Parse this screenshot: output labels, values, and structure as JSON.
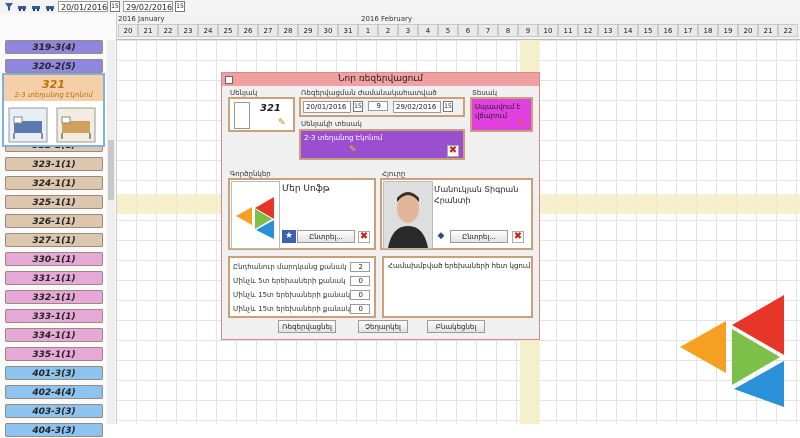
{
  "toolbar": {
    "start_date": "20/01/2016",
    "end_date": "29/02/2016",
    "cal_label": "15"
  },
  "timeline": {
    "month1": "2016 January",
    "month2": "2016 February",
    "days": [
      "20",
      "21",
      "22",
      "23",
      "24",
      "25",
      "26",
      "27",
      "28",
      "29",
      "30",
      "31",
      "1",
      "2",
      "3",
      "4",
      "5",
      "6",
      "7",
      "8",
      "9",
      "10",
      "11",
      "12",
      "13",
      "14",
      "15",
      "16",
      "17",
      "18",
      "19",
      "20",
      "21",
      "22"
    ]
  },
  "rooms": [
    {
      "label": "319-3(4)",
      "color": "#8f86e0"
    },
    {
      "label": "320-2(5)",
      "color": "#8f86e0"
    },
    {
      "label": "322-1(1)",
      "color": "#dcc7ae"
    },
    {
      "label": "323-1(1)",
      "color": "#dcc7ae"
    },
    {
      "label": "324-1(1)",
      "color": "#dcc7ae"
    },
    {
      "label": "325-1(1)",
      "color": "#dcc7ae"
    },
    {
      "label": "326-1(1)",
      "color": "#dcc7ae"
    },
    {
      "label": "327-1(1)",
      "color": "#dcc7ae"
    },
    {
      "label": "330-1(1)",
      "color": "#e6a8d6"
    },
    {
      "label": "331-1(1)",
      "color": "#e6a8d6"
    },
    {
      "label": "332-1(1)",
      "color": "#e6a8d6"
    },
    {
      "label": "333-1(1)",
      "color": "#e6a8d6"
    },
    {
      "label": "334-1(1)",
      "color": "#e6a8d6"
    },
    {
      "label": "335-1(1)",
      "color": "#e6a8d6"
    },
    {
      "label": "401-3(3)",
      "color": "#8dc4ef"
    },
    {
      "label": "402-4(4)",
      "color": "#8dc4ef"
    },
    {
      "label": "403-3(3)",
      "color": "#8dc4ef"
    },
    {
      "label": "404-3(3)",
      "color": "#8dc4ef"
    }
  ],
  "selected_room": {
    "number": "321",
    "type": "2-3 տեղանոց Էկոնոմ"
  },
  "dialog": {
    "title": "Նոր ռեզերվացում",
    "room_label": "Սենյակ",
    "room_number": "321",
    "period_label": "Ռեզերվացման ժամանակահատված",
    "start_date": "20/01/2016",
    "nights": "9",
    "end_date": "29/02/2016",
    "cal_label": "15",
    "type_label": "Տեսակ",
    "type_value": "Սպասվում է վճարում",
    "room_type_label": "Սենյակի տեսակ",
    "room_type_value": "2-3 տեղանոց Էկոնոմ",
    "partners_label": "Գործընկեր",
    "partner_name": "Մեր Սոֆթ",
    "partner_btn": "Ընտրել...",
    "guest_label": "Հյուրը",
    "guest_name": "Մանուկյան Տիգրան Հրանտի",
    "guest_btn": "Ընտրել...",
    "counts": [
      {
        "label": "Ընդհանուր մարդկանց քանակ",
        "value": "2"
      },
      {
        "label": "Մինչև 5տ երեխաների քանակ",
        "value": "0"
      },
      {
        "label": "Մինչև 15տ երեխաների քանակ",
        "value": "0"
      },
      {
        "label": "Մինչև 15տ երեխաների քանակ",
        "value": "0"
      }
    ],
    "notes_label": "Համախմբված երեխաների հետ կցում",
    "btn_reserve": "Ռեզերվացնել",
    "btn_cancel": "Չեղարկել",
    "btn_close": "Բնակեցնել"
  },
  "colors": {
    "accent": "#f0a0a0",
    "type_bg": "#e040e0",
    "room_type_bg": "#9a4ed0",
    "highlight_row": "#f5ecc0"
  }
}
